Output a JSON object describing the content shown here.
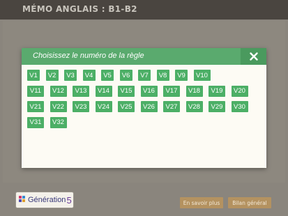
{
  "app": {
    "title": "MÉMO ANGLAIS : B1-B2"
  },
  "modal": {
    "title": "Choisissez le numéro de la règle",
    "close_icon": "close-icon",
    "rows": [
      [
        "V1",
        "V2",
        "V3",
        "V4",
        "V5",
        "V6",
        "V7",
        "V8",
        "V9",
        "V10"
      ],
      [
        "V11",
        "V12",
        "V13",
        "V14",
        "V15",
        "V16",
        "V17",
        "V18",
        "V19",
        "V20"
      ],
      [
        "V21",
        "V22",
        "V23",
        "V24",
        "V25",
        "V26",
        "V27",
        "V28",
        "V29",
        "V30"
      ],
      [
        "V31",
        "V32"
      ]
    ]
  },
  "footer": {
    "logo_text": "Génération",
    "logo_number": "5",
    "more_label": "En savoir plus",
    "bilan_label": "Bilan général"
  },
  "colors": {
    "header_green": "#5aaa6e",
    "rule_green": "#4caf66",
    "footer_button": "#b49260",
    "background": "#8a857d"
  }
}
